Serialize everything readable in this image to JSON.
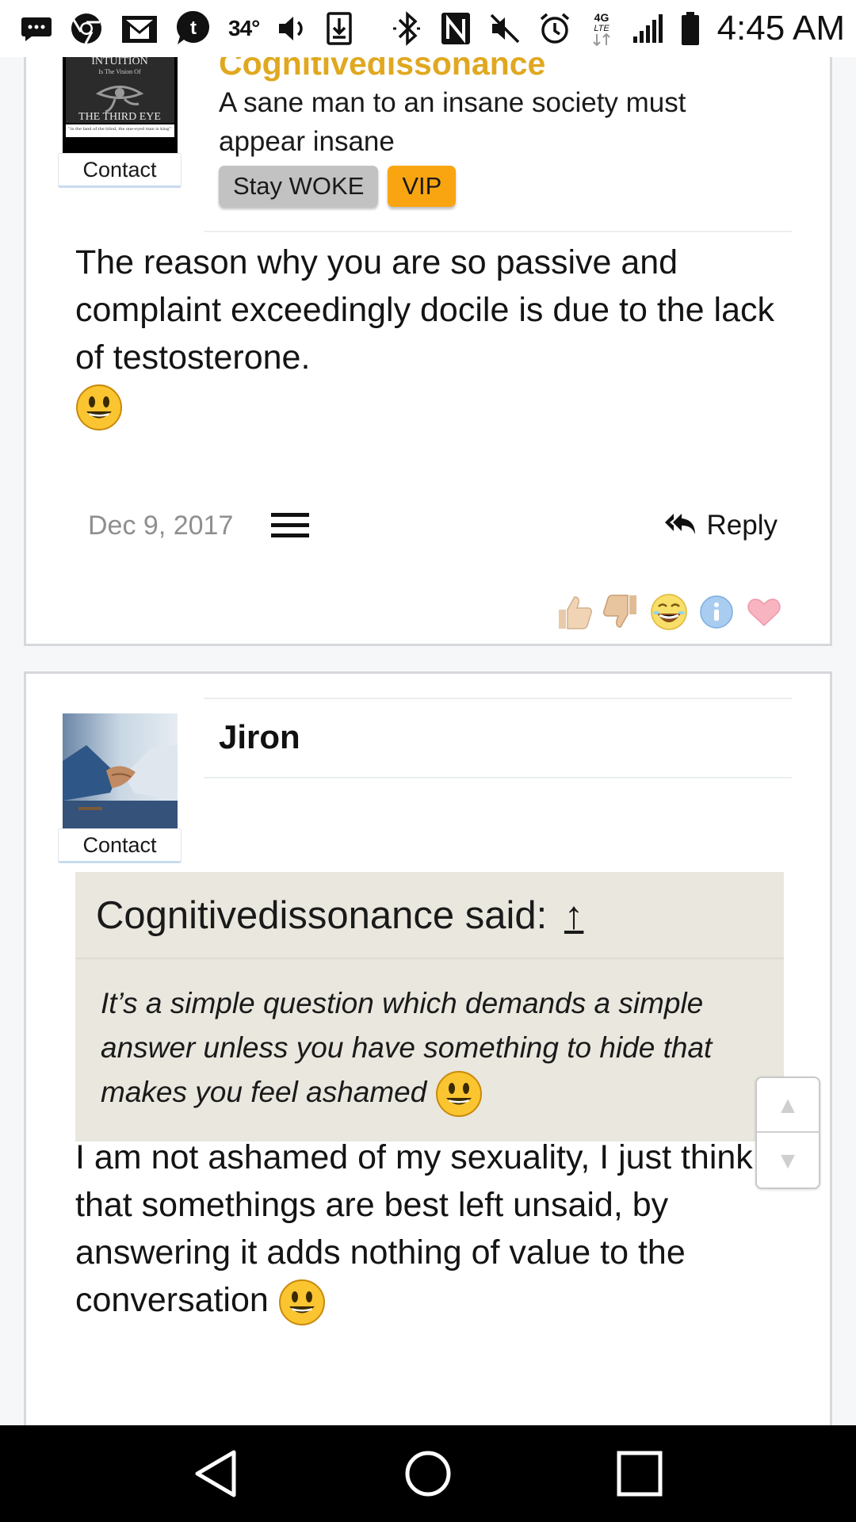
{
  "status_bar": {
    "temperature": "34°",
    "time": "4:45 AM",
    "network": "4G LTE",
    "icons": [
      "messages-icon",
      "chrome-icon",
      "gmail-icon",
      "tumblr-icon",
      "volume-icon",
      "download-icon",
      "bluetooth-icon",
      "nfc-icon",
      "mute-icon",
      "alarm-icon",
      "network-4g-lte-icon",
      "signal-icon",
      "battery-icon"
    ]
  },
  "posts": [
    {
      "username": "Cognitivedissonance",
      "user_title": "A sane man to an insane society must appear insane",
      "contact_label": "Contact",
      "avatar_text": {
        "line1": "INTUITION",
        "line2": "Is The Vision Of",
        "line3": "THE THIRD EYE",
        "line4": "\"in the land of the blind, the one-eyed man is king\""
      },
      "badges": [
        "Stay WOKE",
        "VIP"
      ],
      "message": "The reason why you are so passive and complaint exceedingly docile is due to the lack of testosterone.",
      "date": "Dec 9, 2017",
      "reply_label": "Reply",
      "reactions": [
        "like-icon",
        "dislike-icon",
        "laugh-icon",
        "info-icon",
        "love-icon"
      ]
    },
    {
      "username": "Jiron",
      "contact_label": "Contact",
      "quote": {
        "author_line": "Cognitivedissonance said:",
        "arrow": "↑",
        "text": "It’s a simple question which demands a simple answer unless you have something to hide that makes you feel ashamed"
      },
      "message": "I am not ashamed of my sexuality, I just think that somethings are best left unsaid, by answering it adds nothing of value to the conversation"
    }
  ],
  "scroll_nav": {
    "up": "▲",
    "down": "▼"
  },
  "colors": {
    "username_gold": "#e0a820",
    "vip_badge": "#f9a512",
    "quote_bg": "#e9e7de"
  }
}
